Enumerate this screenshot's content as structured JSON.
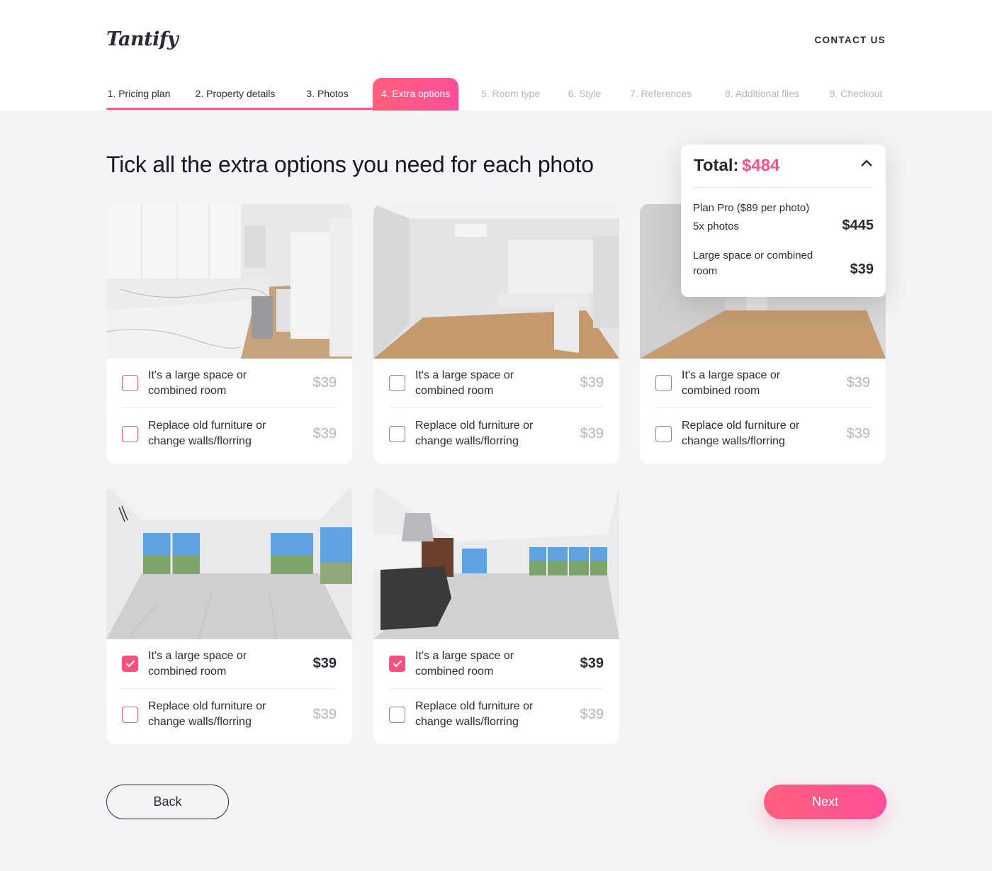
{
  "header": {
    "logo": "Tantify",
    "contact_label": "CONTACT US"
  },
  "steps": [
    {
      "label": "1. Pricing plan",
      "state": "done"
    },
    {
      "label": "2. Property details",
      "state": "done"
    },
    {
      "label": "3. Photos",
      "state": "done"
    },
    {
      "label": "4. Extra options",
      "state": "active"
    },
    {
      "label": "5. Room type",
      "state": "todo"
    },
    {
      "label": "6. Style",
      "state": "todo"
    },
    {
      "label": "7. References",
      "state": "todo"
    },
    {
      "label": "8. Additional files",
      "state": "todo"
    },
    {
      "label": "9. Checkout",
      "state": "todo"
    }
  ],
  "main": {
    "heading": "Tick all the extra options you need for each photo"
  },
  "photos": [
    {
      "scene": "kitchen",
      "options": [
        {
          "label": "It's a large space or combined room",
          "price": "$39",
          "checked": false
        },
        {
          "label": "Replace old furniture or change walls/florring",
          "price": "$39",
          "checked": false
        }
      ]
    },
    {
      "scene": "kitchen-room",
      "options": [
        {
          "label": "It's a large space or combined room",
          "price": "$39",
          "checked": false
        },
        {
          "label": "Replace old furniture or change walls/florring",
          "price": "$39",
          "checked": false
        }
      ]
    },
    {
      "scene": "empty-room",
      "options": [
        {
          "label": "It's a large space or combined room",
          "price": "$39",
          "checked": false
        },
        {
          "label": "Replace old furniture or change walls/florring",
          "price": "$39",
          "checked": false
        }
      ]
    },
    {
      "scene": "living-windows",
      "options": [
        {
          "label": "It's a large space or combined room",
          "price": "$39",
          "checked": true
        },
        {
          "label": "Replace old furniture or change walls/florring",
          "price": "$39",
          "checked": false
        }
      ]
    },
    {
      "scene": "open-kitchen",
      "options": [
        {
          "label": "It's a large space or combined room",
          "price": "$39",
          "checked": true
        },
        {
          "label": "Replace old furniture or change walls/florring",
          "price": "$39",
          "checked": false
        }
      ]
    }
  ],
  "summary": {
    "total_label": "Total:",
    "total_value": "$484",
    "plan_line1": "Plan Pro ($89 per photo)",
    "plan_line2": "5x photos",
    "plan_price": "$445",
    "extra_label": "Large space or combined room",
    "extra_price": "$39"
  },
  "footer": {
    "back_label": "Back",
    "next_label": "Next"
  },
  "colors": {
    "accent": "#ff4f88",
    "background": "#f4f4f6",
    "text": "#22222e"
  },
  "icons": {
    "checkbox": "checkbox-icon",
    "checkmark": "checkmark-icon",
    "chevron": "chevron-up-icon"
  }
}
